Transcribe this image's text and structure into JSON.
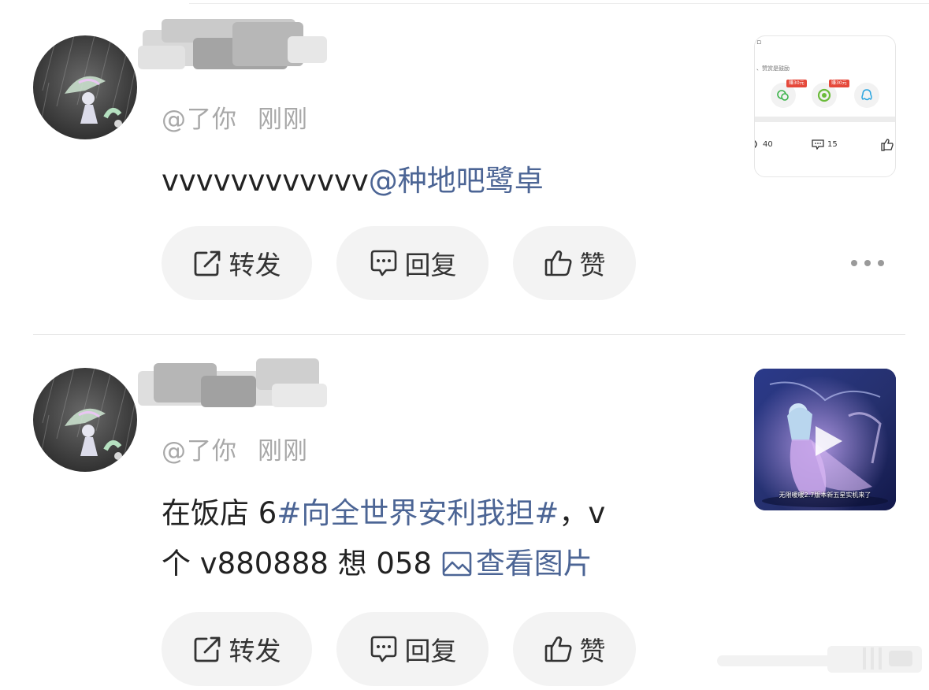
{
  "posts": [
    {
      "handle": "@了你",
      "time": "刚刚",
      "content_text": "vvvvvvvvvvvv",
      "content_link": "@种地吧鹭卓",
      "actions": {
        "repost": "转发",
        "comment": "回复",
        "like": "赞"
      },
      "thumbnail": {
        "type": "share-sheet-screenshot",
        "caption": "、赞赏是鼓励",
        "badge_1": "赚30元",
        "badge_2": "赚30元",
        "stat_1": "40",
        "stat_2": "15",
        "icons": [
          "wechat-icon",
          "moments-icon",
          "qq-icon",
          "comment-icon",
          "like-icon"
        ]
      }
    },
    {
      "handle": "@了你",
      "time": "刚刚",
      "content_line1_text": "在饭店 6",
      "content_line1_topic": "#向全世界安利我担#",
      "content_line1_tail": "，v",
      "content_line2_text": "个 v880888 想 058 ",
      "content_line2_link": "查看图片",
      "actions": {
        "repost": "转发",
        "comment": "回复",
        "like": "赞"
      },
      "thumbnail": {
        "type": "video",
        "caption": "无限暖暖2.7版本新五星实机来了"
      }
    }
  ],
  "colors": {
    "link": "#4c6595",
    "button_bg": "#f3f3f3",
    "handle": "#a8a8a8",
    "badge": "#e5483a"
  },
  "icons": [
    "repost-icon",
    "comment-icon",
    "like-icon",
    "more-icon",
    "image-icon",
    "play-icon"
  ]
}
